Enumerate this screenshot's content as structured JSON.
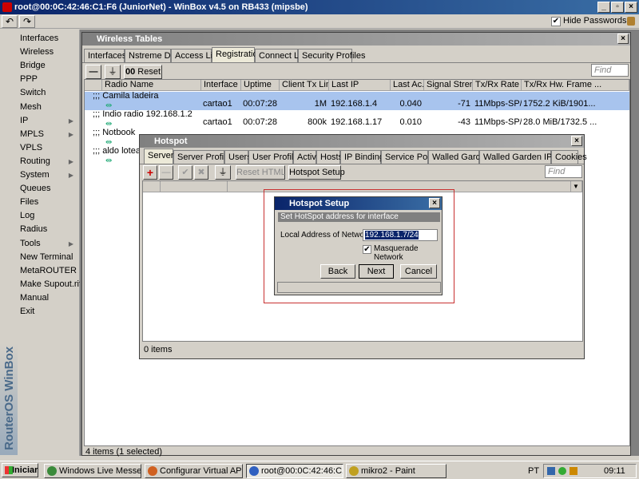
{
  "window": {
    "title": "root@00:0C:42:46:C1:F6 (JuniorNet) - WinBox v4.5 on RB433 (mipsbe)"
  },
  "toolbar": {
    "undo": "↶",
    "redo": "↷",
    "hide_passwords": "Hide Passwords",
    "hide_passwords_checked": true
  },
  "sidebar": {
    "items": [
      {
        "label": "Interfaces",
        "sub": false
      },
      {
        "label": "Wireless",
        "sub": false
      },
      {
        "label": "Bridge",
        "sub": false
      },
      {
        "label": "PPP",
        "sub": false
      },
      {
        "label": "Switch",
        "sub": false
      },
      {
        "label": "Mesh",
        "sub": false
      },
      {
        "label": "IP",
        "sub": true
      },
      {
        "label": "MPLS",
        "sub": true
      },
      {
        "label": "VPLS",
        "sub": false
      },
      {
        "label": "Routing",
        "sub": true
      },
      {
        "label": "System",
        "sub": true
      },
      {
        "label": "Queues",
        "sub": false
      },
      {
        "label": "Files",
        "sub": false
      },
      {
        "label": "Log",
        "sub": false
      },
      {
        "label": "Radius",
        "sub": false
      },
      {
        "label": "Tools",
        "sub": true
      },
      {
        "label": "New Terminal",
        "sub": false
      },
      {
        "label": "MetaROUTER",
        "sub": false
      },
      {
        "label": "Make Supout.rif",
        "sub": false
      },
      {
        "label": "Manual",
        "sub": false
      },
      {
        "label": "Exit",
        "sub": false
      }
    ],
    "brand": "RouterOS WinBox"
  },
  "wireless": {
    "title": "Wireless Tables",
    "tabs": [
      "Interfaces",
      "Nstreme Dual",
      "Access List",
      "Registration",
      "Connect List",
      "Security Profiles"
    ],
    "active_tab": 3,
    "reset": "Reset",
    "find_placeholder": "Find",
    "columns": [
      "Radio Name",
      "Interface",
      "Uptime",
      "Client Tx Limit",
      "Last IP",
      "Last Ac...",
      "Signal Strengt...",
      "Tx/Rx Rate",
      "Tx/Rx Hw. Frame ..."
    ],
    "rows": [
      {
        "comment": ";;; Camila ladeira",
        "interface": "cartao1",
        "uptime": "00:07:28",
        "limit": "1M",
        "ip": "192.168.1.4",
        "last": "0.040",
        "signal": "-71",
        "rate": "11Mbps-SP/...",
        "frames": "1752.2 KiB/1901...",
        "selected": true
      },
      {
        "comment": ";;; Indio radio 192.168.1.2",
        "interface": "cartao1",
        "uptime": "00:07:28",
        "limit": "800k",
        "ip": "192.168.1.17",
        "last": "0.010",
        "signal": "-43",
        "rate": "11Mbps-SP/...",
        "frames": "28.0 MiB/1732.5 ...",
        "selected": false
      },
      {
        "comment": ";;; Notbook",
        "interface": "",
        "uptime": "",
        "limit": "",
        "ip": "",
        "last": "",
        "signal": "",
        "rate": "",
        "frames": "iB",
        "selected": false
      },
      {
        "comment": ";;; aldo loteame",
        "interface": "",
        "uptime": "",
        "limit": "",
        "ip": "",
        "last": "",
        "signal": "",
        "rate": "",
        "frames": "4 ...",
        "selected": false
      }
    ],
    "status": "4 items (1 selected)"
  },
  "hotspot": {
    "title": "Hotspot",
    "tabs": [
      "Servers",
      "Server Profiles",
      "Users",
      "User Profiles",
      "Active",
      "Hosts",
      "IP Bindings",
      "Service Ports",
      "Walled Garden",
      "Walled Garden IP List",
      "Cookies"
    ],
    "active_tab": 0,
    "reset_html": "Reset HTML",
    "setup": "Hotspot Setup",
    "find_placeholder": "Find",
    "status": "0 items"
  },
  "setup": {
    "title": "Hotspot Setup",
    "subtitle": "Set HotSpot address for interface",
    "field_label": "Local Address of Network:",
    "field_value": "192.168.1.7/24",
    "masquerade": "Masquerade Network",
    "masquerade_checked": true,
    "back": "Back",
    "next": "Next",
    "cancel": "Cancel"
  },
  "taskbar": {
    "start": "Iniciar",
    "tasks": [
      {
        "label": "Windows Live Messenger",
        "color": "#3a8a3a",
        "active": false
      },
      {
        "label": "Configurar Virtual AP - P...",
        "color": "#d06020",
        "active": false
      },
      {
        "label": "root@00:0C:42:46:C1:...",
        "color": "#3060c0",
        "active": true
      },
      {
        "label": "mikro2 - Paint",
        "color": "#c0a020",
        "active": false
      }
    ],
    "lang": "PT",
    "clock": "09:11"
  },
  "colors": {
    "selection": "#a8c4ee",
    "highlight": "#0a246a",
    "accent_red": "#c83030"
  }
}
